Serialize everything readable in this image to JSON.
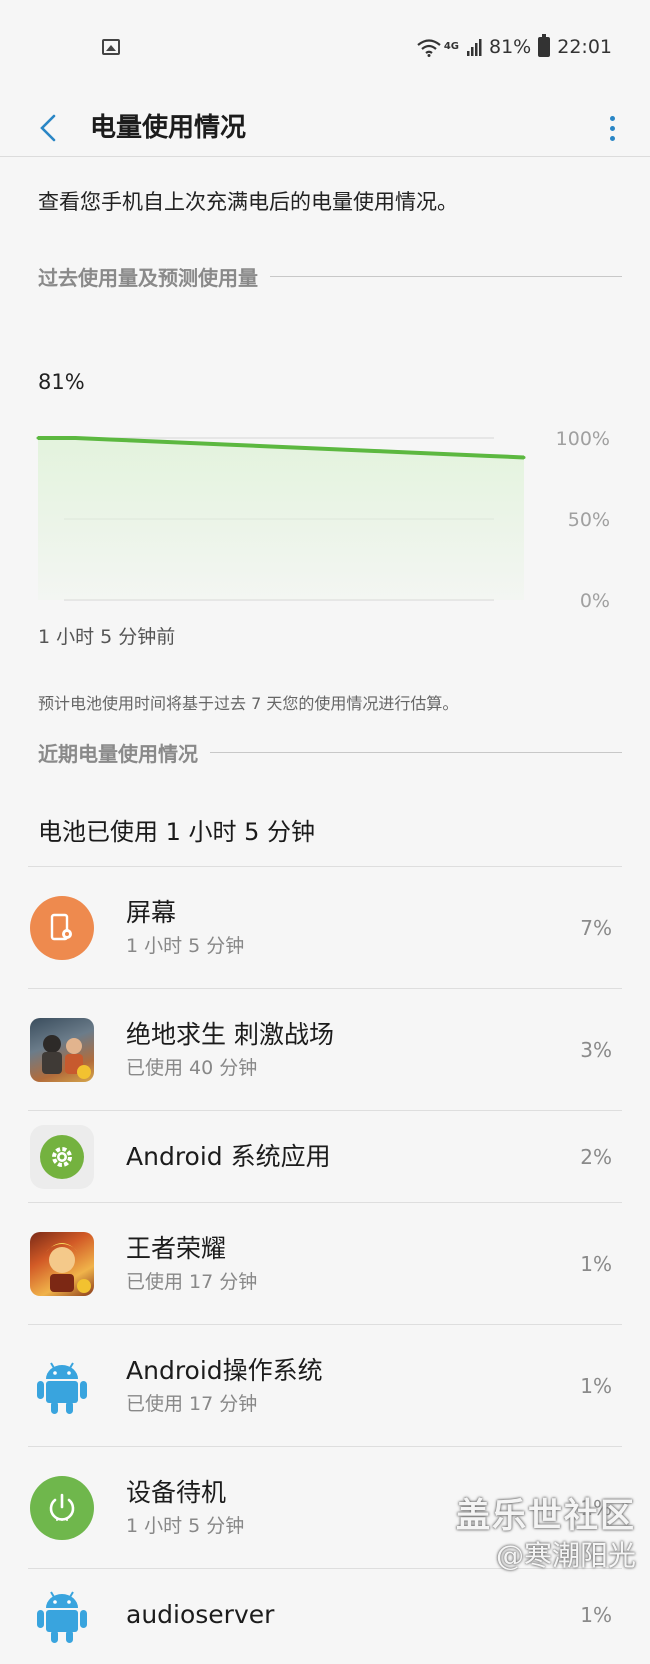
{
  "status_bar": {
    "network": "4G",
    "battery": "81%",
    "time": "22:01"
  },
  "header": {
    "title": "电量使用情况"
  },
  "intro": "查看您手机自上次充满电后的电量使用情况。",
  "section_usage": {
    "title": "过去使用量及预测使用量"
  },
  "chart": {
    "current_level": "81%",
    "time_label": "1 小时 5 分钟前",
    "note": "预计电池使用时间将基于过去 7 天您的使用情况进行估算。"
  },
  "chart_data": {
    "type": "area",
    "title": "",
    "xlabel": "",
    "ylabel": "",
    "y_ticks": [
      "100%",
      "50%",
      "0%"
    ],
    "ylim": [
      0,
      100
    ],
    "series": [
      {
        "x": [
          0,
          5,
          10,
          15,
          20,
          25,
          30,
          35,
          40,
          45,
          50,
          55,
          60,
          65
        ],
        "values": [
          100,
          100,
          99,
          98,
          97,
          96,
          95,
          94,
          93,
          92,
          91,
          90,
          89,
          88
        ]
      }
    ],
    "grid": true,
    "line_color": "#5cb840",
    "fill_color": "#e3f3dd"
  },
  "section_recent": {
    "title": "近期电量使用情况"
  },
  "usage_total": "电池已使用 1 小时 5 分钟",
  "apps": [
    {
      "name": "屏幕",
      "sub": "1 小时 5 分钟",
      "pct": "7%",
      "icon": "screen-icon"
    },
    {
      "name": "绝地求生 刺激战场",
      "sub": "已使用 40 分钟",
      "pct": "3%",
      "icon": "pubg-icon"
    },
    {
      "name": "Android 系统应用",
      "sub": "",
      "pct": "2%",
      "icon": "gear-icon"
    },
    {
      "name": "王者荣耀",
      "sub": "已使用 17 分钟",
      "pct": "1%",
      "icon": "honor-of-kings-icon"
    },
    {
      "name": "Android操作系统",
      "sub": "已使用 17 分钟",
      "pct": "1%",
      "icon": "android-icon"
    },
    {
      "name": "设备待机",
      "sub": "1 小时 5 分钟",
      "pct": "1%",
      "icon": "power-icon"
    },
    {
      "name": "audioserver",
      "sub": "",
      "pct": "1%",
      "icon": "android-icon"
    }
  ],
  "watermark": {
    "line1": "盖乐世社区",
    "line2": "@寒潮阳光"
  }
}
